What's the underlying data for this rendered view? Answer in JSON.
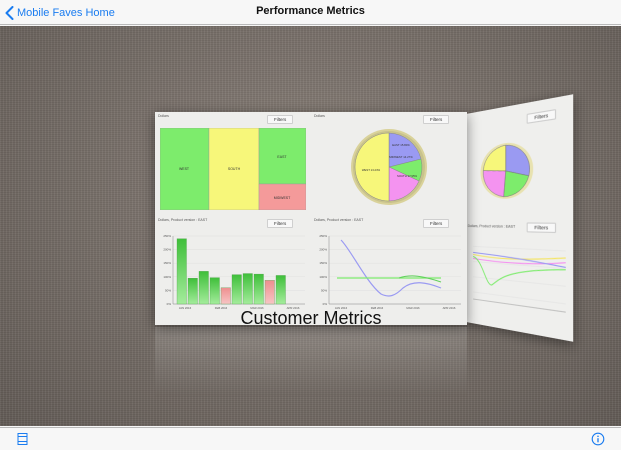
{
  "navbar": {
    "back_label": "Mobile Faves Home",
    "title": "Performance Metrics"
  },
  "card": {
    "label": "Customer Metrics",
    "panels": {
      "treemap": {
        "title": "Dollars",
        "filter_label": "Filters",
        "cells": [
          {
            "label": "WEST",
            "color": "#7dec6c"
          },
          {
            "label": "SOUTH",
            "color": "#f7f77a"
          },
          {
            "label": "EAST",
            "color": "#7dec6c"
          },
          {
            "label": "MIDWEST",
            "color": "#f49a9a"
          }
        ]
      },
      "pie": {
        "title": "Dollars",
        "filter_label": "Filters",
        "slices": [
          {
            "label": "WEST 13.23%",
            "color": "#f7f77a"
          },
          {
            "label": "EAST 15.80%",
            "color": "#9a9af2"
          },
          {
            "label": "MIDWEST 14.27%",
            "color": "#7dec6c"
          },
          {
            "label": "SOUTH 17.95%",
            "color": "#f493f0"
          }
        ]
      },
      "bar": {
        "title": "Dollars, Product version : EAST",
        "filter_label": "Filters",
        "y_ticks": [
          "0%",
          "50%",
          "100%",
          "150%",
          "200%",
          "250%"
        ],
        "x_ticks": [
          "JAN 2016",
          "FEB 2016",
          "MAR 2016",
          "APR 2016"
        ],
        "bars": [
          {
            "value": 240,
            "color": "#3fbf3a"
          },
          {
            "value": 95,
            "color": "#3fbf3a"
          },
          {
            "value": 120,
            "color": "#3fbf3a"
          },
          {
            "value": 97,
            "color": "#3fbf3a"
          },
          {
            "value": 60,
            "color": "#ee8f8f"
          },
          {
            "value": 108,
            "color": "#3fbf3a"
          },
          {
            "value": 112,
            "color": "#3fbf3a"
          },
          {
            "value": 110,
            "color": "#3fbf3a"
          },
          {
            "value": 87,
            "color": "#ee8f8f"
          },
          {
            "value": 105,
            "color": "#3fbf3a"
          }
        ]
      },
      "line": {
        "title": "Dollars, Product version : EAST",
        "filter_label": "Filters",
        "y_ticks": [
          "0%",
          "50%",
          "100%",
          "150%",
          "200%",
          "250%"
        ],
        "x_ticks": [
          "JAN 2016",
          "FEB 2016",
          "MAR 2016",
          "APR 2016"
        ]
      }
    }
  },
  "side_card": {
    "filter_label": "Filters",
    "panel_title": "Dollars, Product version : EAST"
  },
  "tabbar": {
    "left_icon": "list-icon",
    "right_icon": "info-icon"
  },
  "colors": {
    "accent": "#1a7cf0",
    "background": "#6f6761"
  }
}
